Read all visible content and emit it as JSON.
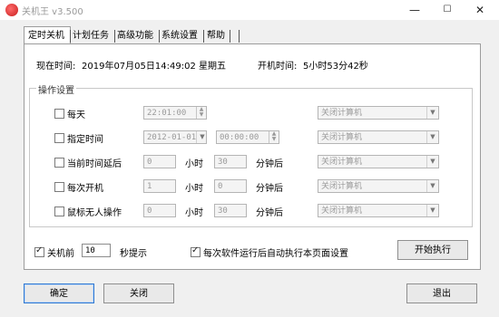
{
  "window": {
    "title": "关机王 v3.500",
    "min": "—",
    "max": "☐",
    "close": "✕"
  },
  "tabs": [
    "定时关机",
    "计划任务",
    "高级功能",
    "系统设置",
    "帮助"
  ],
  "status": {
    "now_label": "现在时间:",
    "now_value": "2019年07月05日14:49:02 星期五",
    "uptime_label": "开机时间:",
    "uptime_value": "5小时53分42秒"
  },
  "group": {
    "title": "操作设置"
  },
  "rows": [
    {
      "label": "每天",
      "time": "22:01:00",
      "action": "关闭计算机"
    },
    {
      "label": "指定时间",
      "date": "2012-01-01",
      "time": "00:00:00",
      "action": "关闭计算机"
    },
    {
      "label": "当前时间延后",
      "hours": "0",
      "hours_unit": "小时",
      "minutes": "30",
      "minutes_unit": "分钟后",
      "action": "关闭计算机"
    },
    {
      "label": "每次开机",
      "hours": "1",
      "hours_unit": "小时",
      "minutes": "0",
      "minutes_unit": "分钟后",
      "action": "关闭计算机"
    },
    {
      "label": "鼠标无人操作",
      "hours": "0",
      "hours_unit": "小时",
      "minutes": "30",
      "minutes_unit": "分钟后",
      "action": "关闭计算机"
    }
  ],
  "bottom": {
    "pre_label": "关机前",
    "pre_value": "10",
    "pre_suffix": "秒提示",
    "auto_label": "每次软件运行后自动执行本页面设置",
    "start_button": "开始执行"
  },
  "footer": {
    "ok": "确定",
    "close": "关闭",
    "exit": "退出"
  }
}
